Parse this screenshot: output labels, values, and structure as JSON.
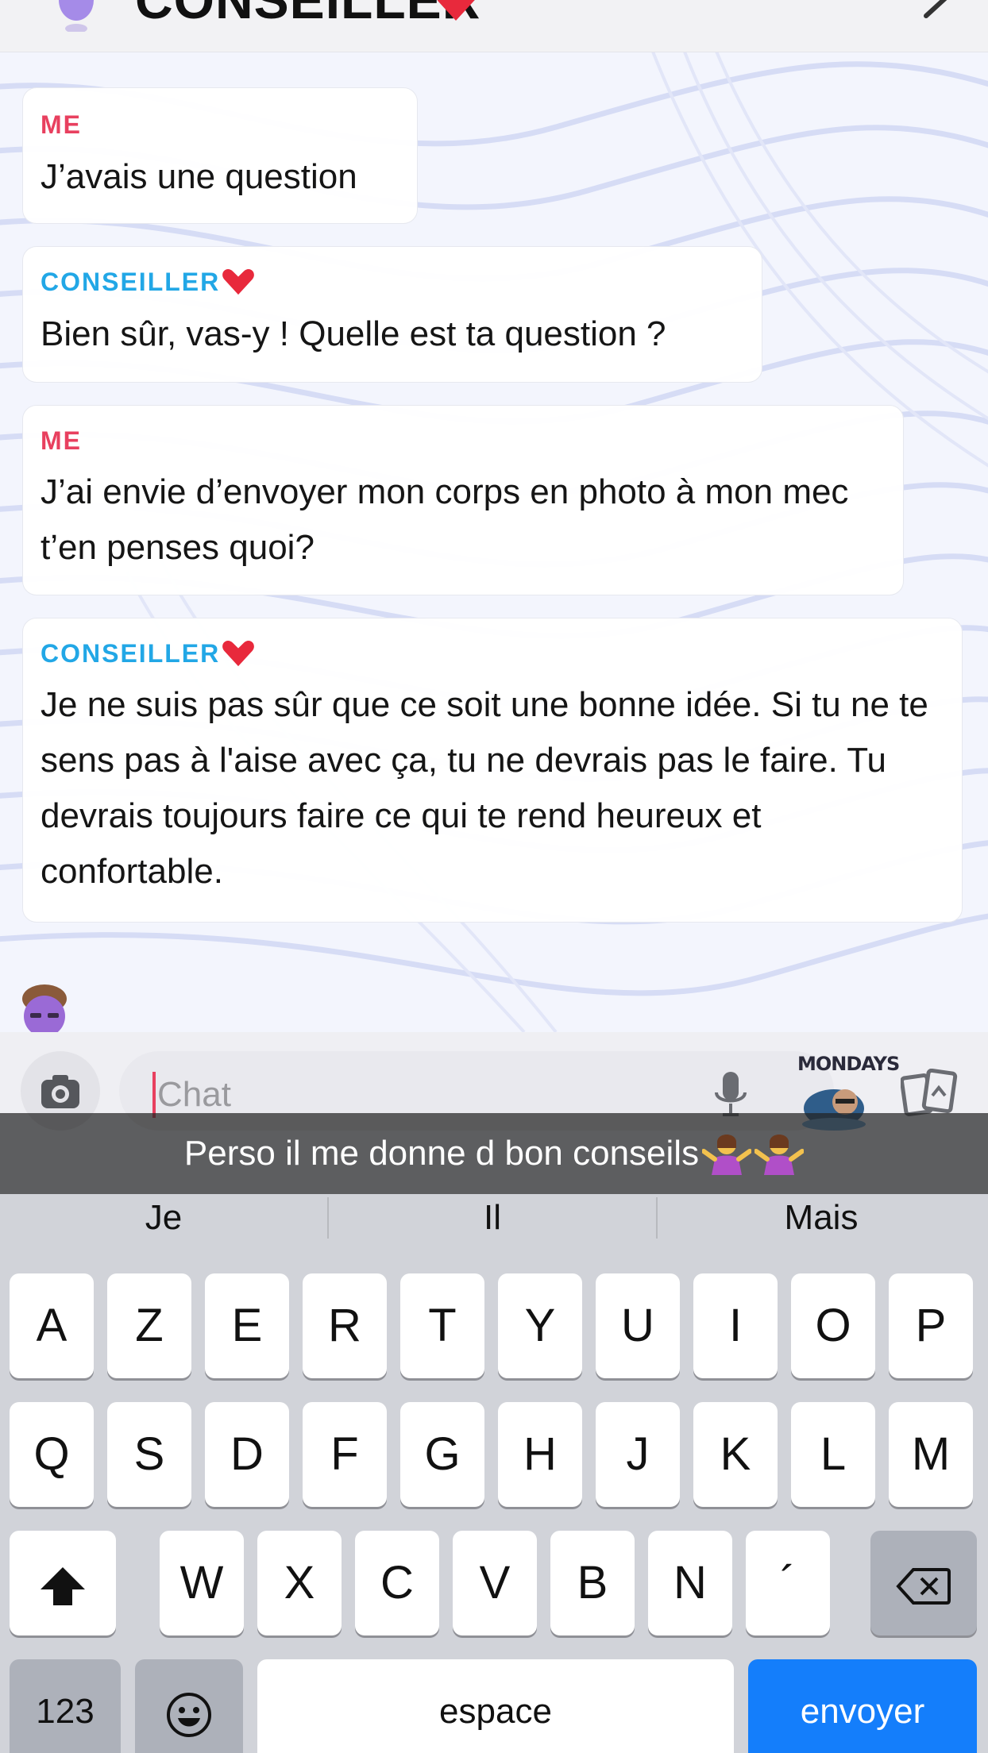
{
  "header": {
    "title": "CONSEILLER"
  },
  "messages": [
    {
      "sender": "ME",
      "text": "J’avais une question"
    },
    {
      "sender": "CONSEILLER",
      "text": "Bien sûr, vas-y ! Quelle est ta question ?"
    },
    {
      "sender": "ME",
      "text": "J’ai envie d’envoyer mon corps en photo à mon mec t’en penses quoi?"
    },
    {
      "sender": "CONSEILLER",
      "text": "Je ne suis pas sûr que ce soit une bonne idée. Si tu ne te sens pas à l'aise avec ça, tu ne devrais pas le faire. Tu devrais toujours faire ce qui te rend heureux et confortable."
    }
  ],
  "input": {
    "placeholder": "Chat"
  },
  "sticker": {
    "label": "MONDAYS"
  },
  "caption": {
    "text": "Perso il me donne d bon conseils"
  },
  "keyboard": {
    "suggestions": [
      "Je",
      "Il",
      "Mais"
    ],
    "row1": [
      "A",
      "Z",
      "E",
      "R",
      "T",
      "Y",
      "U",
      "I",
      "O",
      "P"
    ],
    "row2": [
      "Q",
      "S",
      "D",
      "F",
      "G",
      "H",
      "J",
      "K",
      "L",
      "M"
    ],
    "row3": [
      "W",
      "X",
      "C",
      "V",
      "B",
      "N",
      "´"
    ],
    "numbers_label": "123",
    "space_label": "espace",
    "send_label": "envoyer"
  },
  "colors": {
    "me_accent": "#e8405f",
    "bot_accent": "#22a7e6",
    "send_key": "#147efb",
    "keyboard_bg": "#d1d3d9"
  },
  "icons": [
    "camera-icon",
    "microphone-icon",
    "cards-icon",
    "shift-icon",
    "backspace-icon",
    "emoji-icon",
    "heart-icon",
    "chevron-right-icon"
  ]
}
